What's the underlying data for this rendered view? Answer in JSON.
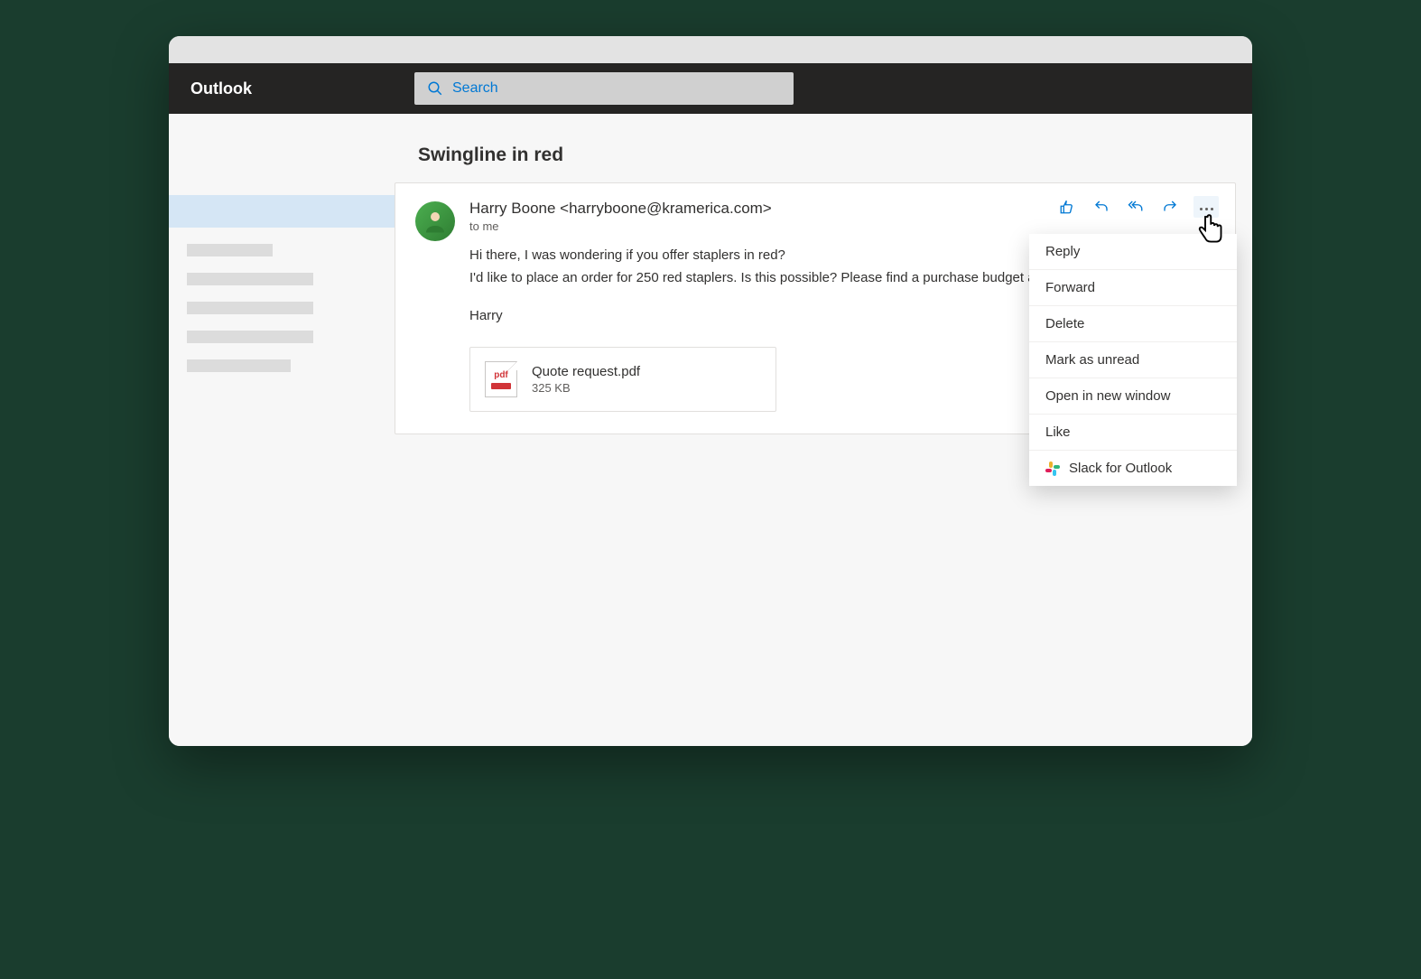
{
  "header": {
    "app_name": "Outlook",
    "search_placeholder": "Search"
  },
  "email": {
    "subject": "Swingline in red",
    "sender": "Harry Boone <harryboone@kramerica.com>",
    "recipient": "to me",
    "body_line1": "Hi there, I was wondering if you offer staplers in red?",
    "body_line2": "I'd like to place an order for 250 red staplers. Is this possible? Please find a purchase budget and exact specifications.",
    "signature": "Harry",
    "attachment": {
      "name": "Quote request.pdf",
      "size": "325 KB",
      "type_label": "pdf"
    }
  },
  "context_menu": {
    "items": [
      "Reply",
      "Forward",
      "Delete",
      "Mark as unread",
      "Open in new window",
      "Like"
    ],
    "slack_item": "Slack for Outlook"
  }
}
